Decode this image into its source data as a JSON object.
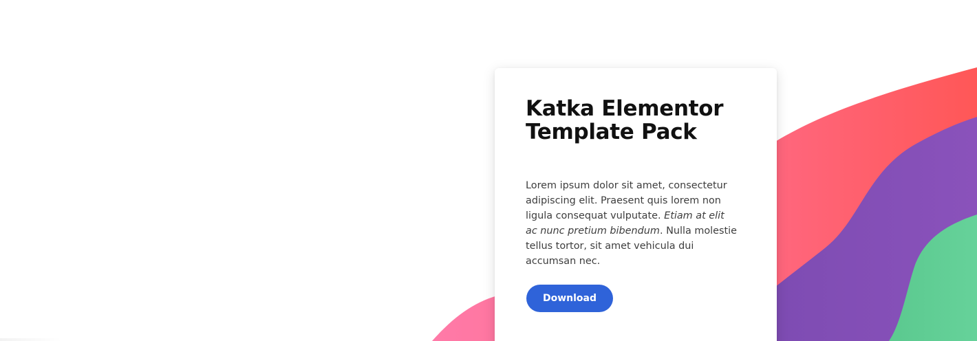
{
  "card": {
    "title": "Katka Elementor Template Pack",
    "body_part1": "Lorem ipsum dolor sit amet, consectetur adipiscing elit. Praesent quis lorem non ligula consequat vulputate. ",
    "body_italic": "Etiam at elit ac nunc pretium bibendum",
    "body_part2": ". Nulla molestie tellus tortor, sit amet vehicula dui accumsan nec.",
    "button_label": "Download"
  },
  "colors": {
    "pink_wave": "#ff6f9c",
    "red_wave": "#ff5a5a",
    "purple_wave": "#7f4fb6",
    "green_wave": "#5ecc94",
    "button": "#2f63d9"
  }
}
